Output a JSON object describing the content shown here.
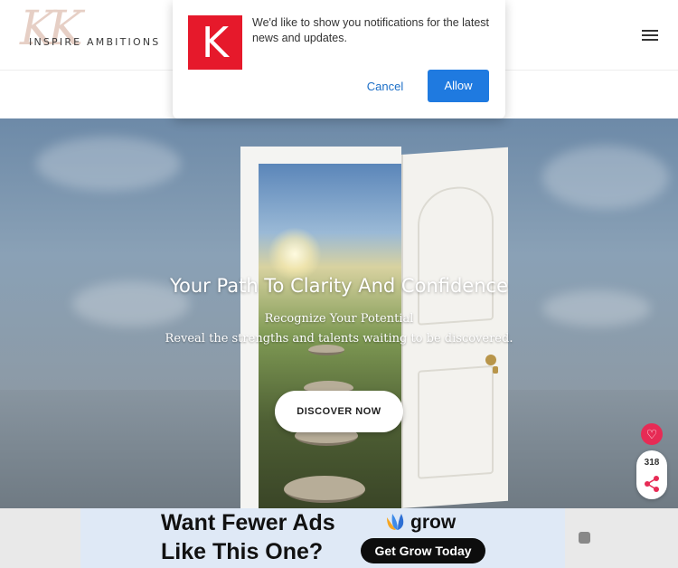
{
  "header": {
    "logo_monogram": "KK",
    "logo_text": "INSPIRE AMBITIONS"
  },
  "notification": {
    "logo_letter": "K",
    "message": "We'd like to show you notifications for the latest news and updates.",
    "cancel_label": "Cancel",
    "allow_label": "Allow",
    "brand_color": "#e6192b",
    "allow_color": "#1f7ae0"
  },
  "hero": {
    "title": "Your Path To Clarity And Confidence",
    "subtitle": "Recognize Your Potential",
    "tagline": "Reveal the strengths and talents waiting to be discovered.",
    "cta_label": "DISCOVER NOW"
  },
  "share": {
    "count": "318",
    "heart_icon": "heart-icon",
    "share_icon": "share-icon",
    "heart_color": "#e72b55"
  },
  "ad": {
    "headline_line1": "Want Fewer Ads",
    "headline_line2": "Like This One?",
    "brand": "grow",
    "cta_label": "Get Grow Today"
  }
}
